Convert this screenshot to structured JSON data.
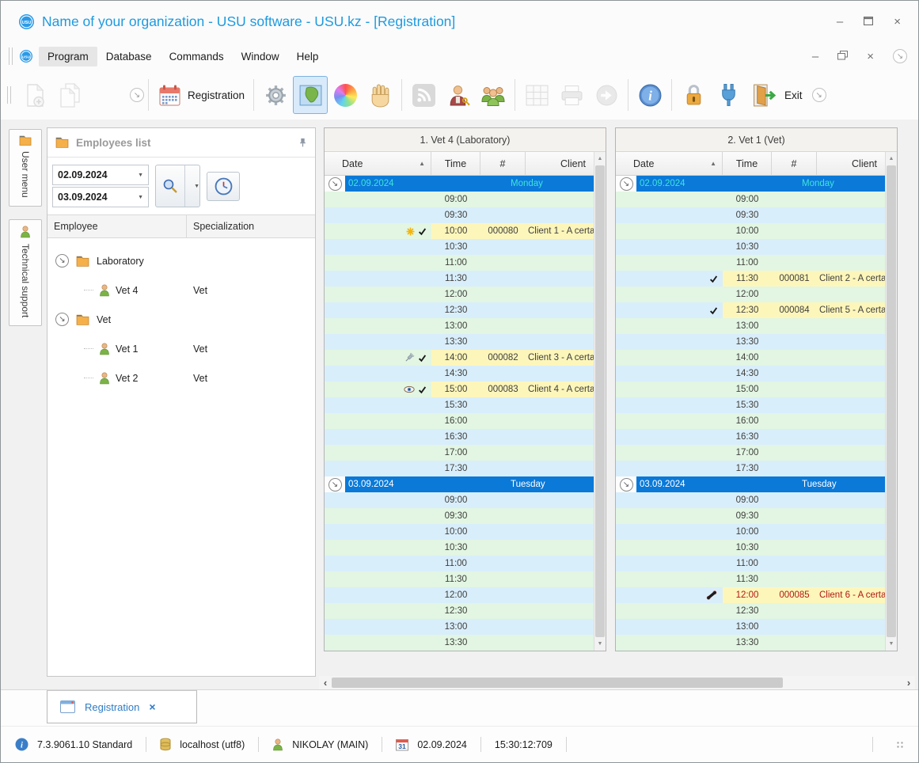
{
  "colors": {
    "title_blue": "#1d9ae0",
    "band_blue": "#0a79d8",
    "band_text_today": "#40e3dc",
    "band_text": "#ffffff",
    "row_green": "#e2f6e3",
    "row_blue": "#d9eefb",
    "appt_yellow": "#fdf6bb",
    "appt_red": "#b01815",
    "row_text": "#3f3f3c"
  },
  "window": {
    "title": "Name of your organization - USU software - USU.kz - [Registration]"
  },
  "menu": {
    "items": [
      "Program",
      "Database",
      "Commands",
      "Window",
      "Help"
    ]
  },
  "toolbar": {
    "registration": "Registration",
    "exit": "Exit"
  },
  "side_tabs": {
    "user_menu": "User menu",
    "technical_support": "Technical support"
  },
  "employees_panel": {
    "title": "Employees list",
    "date_from": "02.09.2024",
    "date_to": "03.09.2024",
    "columns": {
      "employee": "Employee",
      "specialization": "Specialization"
    },
    "tree": [
      {
        "label": "Laboratory",
        "children": [
          {
            "name": "Vet 4",
            "spec": "Vet"
          }
        ]
      },
      {
        "label": "Vet",
        "children": [
          {
            "name": "Vet 1",
            "spec": "Vet"
          },
          {
            "name": "Vet 2",
            "spec": "Vet"
          }
        ]
      }
    ]
  },
  "schedule": {
    "columns": {
      "date": "Date",
      "time": "Time",
      "num": "#",
      "client": "Client"
    },
    "panels": [
      {
        "title": "1. Vet 4 (Laboratory)",
        "sections": [
          {
            "date": "02.09.2024",
            "day": "Monday",
            "today": true,
            "rows": [
              {
                "time": "09:00"
              },
              {
                "time": "09:30"
              },
              {
                "time": "10:00",
                "num": "000080",
                "client": "Client 1 - A certa",
                "icons": [
                  "asterisk-icon",
                  "check-icon"
                ]
              },
              {
                "time": "10:30"
              },
              {
                "time": "11:00"
              },
              {
                "time": "11:30"
              },
              {
                "time": "12:00"
              },
              {
                "time": "12:30"
              },
              {
                "time": "13:00"
              },
              {
                "time": "13:30"
              },
              {
                "time": "14:00",
                "num": "000082",
                "client": "Client 3 - A certa",
                "icons": [
                  "syringe-icon",
                  "check-icon"
                ]
              },
              {
                "time": "14:30"
              },
              {
                "time": "15:00",
                "num": "000083",
                "client": "Client 4 - A certa",
                "icons": [
                  "eye-icon",
                  "check-icon"
                ]
              },
              {
                "time": "15:30"
              },
              {
                "time": "16:00"
              },
              {
                "time": "16:30"
              },
              {
                "time": "17:00"
              },
              {
                "time": "17:30"
              }
            ]
          },
          {
            "date": "03.09.2024",
            "day": "Tuesday",
            "today": false,
            "rows": [
              {
                "time": "09:00"
              },
              {
                "time": "09:30"
              },
              {
                "time": "10:00"
              },
              {
                "time": "10:30"
              },
              {
                "time": "11:00"
              },
              {
                "time": "11:30"
              },
              {
                "time": "12:00"
              },
              {
                "time": "12:30"
              },
              {
                "time": "13:00"
              },
              {
                "time": "13:30"
              }
            ]
          }
        ]
      },
      {
        "title": "2. Vet 1 (Vet)",
        "sections": [
          {
            "date": "02.09.2024",
            "day": "Monday",
            "today": true,
            "rows": [
              {
                "time": "09:00"
              },
              {
                "time": "09:30"
              },
              {
                "time": "10:00"
              },
              {
                "time": "10:30"
              },
              {
                "time": "11:00"
              },
              {
                "time": "11:30",
                "num": "000081",
                "client": "Client 2 - A certa",
                "icons": [
                  "check-icon"
                ]
              },
              {
                "time": "12:00"
              },
              {
                "time": "12:30",
                "num": "000084",
                "client": "Client 5 - A certa",
                "icons": [
                  "check-icon"
                ]
              },
              {
                "time": "13:00"
              },
              {
                "time": "13:30"
              },
              {
                "time": "14:00"
              },
              {
                "time": "14:30"
              },
              {
                "time": "15:00"
              },
              {
                "time": "15:30"
              },
              {
                "time": "16:00"
              },
              {
                "time": "16:30"
              },
              {
                "time": "17:00"
              },
              {
                "time": "17:30"
              }
            ]
          },
          {
            "date": "03.09.2024",
            "day": "Tuesday",
            "today": false,
            "rows": [
              {
                "time": "09:00"
              },
              {
                "time": "09:30"
              },
              {
                "time": "10:00"
              },
              {
                "time": "10:30"
              },
              {
                "time": "11:00"
              },
              {
                "time": "11:30"
              },
              {
                "time": "12:00",
                "num": "000085",
                "client": "Client 6 - A certa",
                "icons": [
                  "phone-icon"
                ],
                "red": true
              },
              {
                "time": "12:30"
              },
              {
                "time": "13:00"
              },
              {
                "time": "13:30"
              }
            ]
          }
        ]
      }
    ]
  },
  "tabbar": {
    "registration_tab": "Registration"
  },
  "statusbar": {
    "version": "7.3.9061.10 Standard",
    "database": "localhost (utf8)",
    "user": "NIKOLAY (MAIN)",
    "date": "02.09.2024",
    "time": "15:30:12:709"
  }
}
